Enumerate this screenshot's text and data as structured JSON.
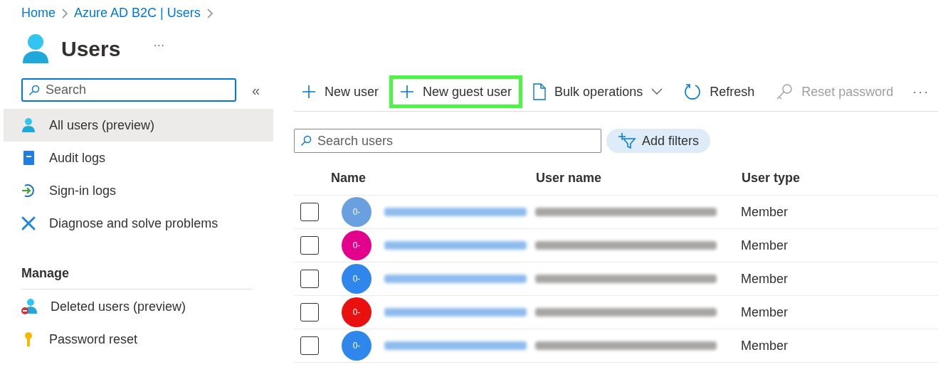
{
  "breadcrumb": [
    {
      "label": "Home"
    },
    {
      "label": "Azure AD B2C | Users"
    }
  ],
  "title": "Users",
  "title_menu": "···",
  "sidebar": {
    "search": {
      "placeholder": "Search"
    },
    "collapse": "«",
    "items": [
      {
        "label": "All users (preview)",
        "kind": "user",
        "selected": true
      },
      {
        "label": "Audit logs",
        "kind": "book",
        "selected": false
      },
      {
        "label": "Sign-in logs",
        "kind": "signin",
        "selected": false
      },
      {
        "label": "Diagnose and solve problems",
        "kind": "tools",
        "selected": false
      }
    ],
    "section": "Manage",
    "manage_items": [
      {
        "label": "Deleted users (preview)",
        "kind": "deleted",
        "selected": false
      },
      {
        "label": "Password reset",
        "kind": "key",
        "selected": false
      }
    ]
  },
  "toolbar": [
    {
      "label": "New user",
      "kind": "plus",
      "disabled": false,
      "highlighted": false
    },
    {
      "label": "New guest user",
      "kind": "plus",
      "disabled": false,
      "highlighted": true
    },
    {
      "label": "Bulk operations",
      "kind": "file",
      "disabled": false,
      "highlighted": false
    },
    {
      "label": "Refresh",
      "kind": "refresh",
      "disabled": false,
      "highlighted": false
    },
    {
      "label": "Reset password",
      "kind": "key",
      "disabled": true,
      "highlighted": false
    }
  ],
  "toolbar_more": "···",
  "search": {
    "placeholder": "Search users"
  },
  "add_filters": "Add filters",
  "table": {
    "columns": [
      "Name",
      "User name",
      "User type"
    ],
    "rows": [
      {
        "checked": false,
        "avatar": "0-",
        "color": "#6a9fe0",
        "user_type": "Member"
      },
      {
        "checked": false,
        "avatar": "0-",
        "color": "#e3008c",
        "user_type": "Member"
      },
      {
        "checked": false,
        "avatar": "0-",
        "color": "#2f86eb",
        "user_type": "Member"
      },
      {
        "checked": false,
        "avatar": "0-",
        "color": "#e8110f",
        "user_type": "Member"
      },
      {
        "checked": false,
        "avatar": "0-",
        "color": "#2f86eb",
        "user_type": "Member"
      }
    ]
  }
}
